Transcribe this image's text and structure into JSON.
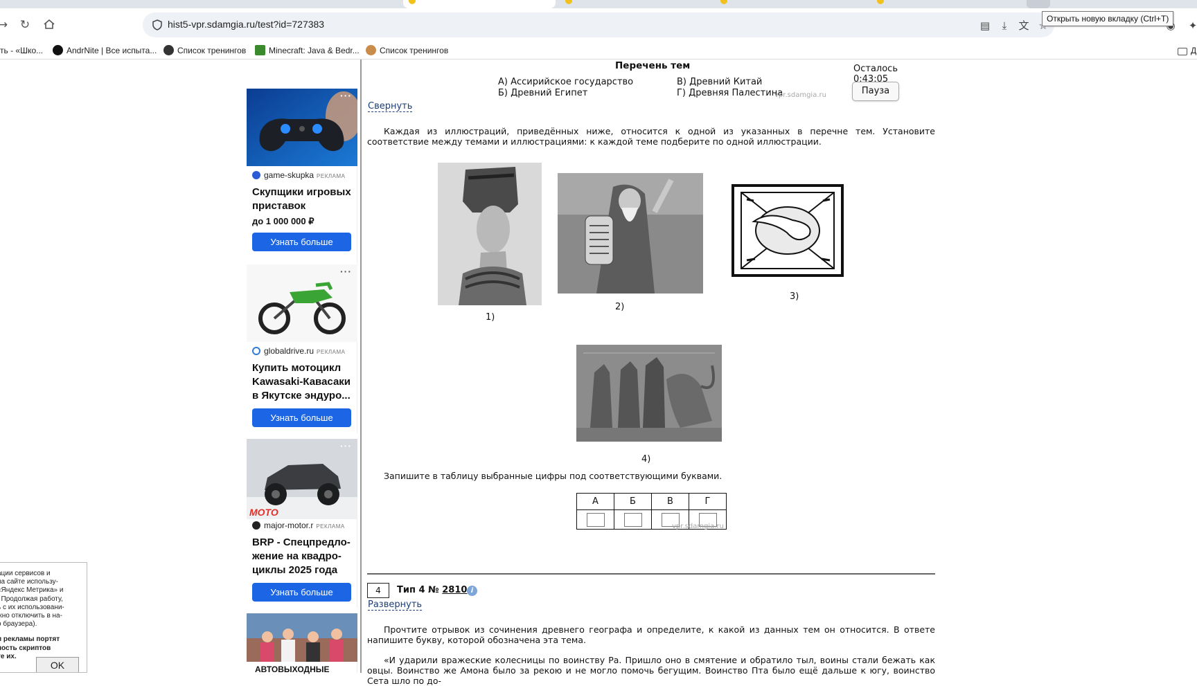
{
  "browser": {
    "url": "hist5-vpr.sdamgia.ru/test?id=727383",
    "tooltip": "Открыть новую вкладку (Ctrl+T)",
    "bookmarks": [
      {
        "label": "ть - «Шко..."
      },
      {
        "label": "AndrNite | Все испыта..."
      },
      {
        "label": "Список тренингов"
      },
      {
        "label": "Minecraft: Java & Bedr..."
      },
      {
        "label": "Список тренингов"
      },
      {
        "label": "Д"
      }
    ]
  },
  "cookie_banner": {
    "text": "ации сервисов и\n на сайте использу-\n «Яндекс Метрика» и\n. Продолжая работу,\nь с их использовани-\nжно отключить в на-\nо браузера).",
    "bold_text": "и рекламы портят\nность скриптов\nте их.",
    "ok_label": "OK"
  },
  "ads": [
    {
      "source": "game-skupka",
      "ad_label": "РЕКЛАМА",
      "title": "Скупщики игровых приставок",
      "price": "до 1 000 000 ₽",
      "button": "Узнать больше"
    },
    {
      "source": "globaldrive.ru",
      "ad_label": "РЕКЛАМА",
      "title": "Купить мотоцикл Kawasaki-Кавасаки в Якутске эндуро...",
      "button": "Узнать больше"
    },
    {
      "source": "major-motor.r",
      "ad_label": "РЕКЛАМА",
      "title": "BRP - Спецпредло-жение на квадро-циклы 2025 года",
      "button": "Узнать больше",
      "img_text": "MOTO"
    },
    {
      "title": "АВТОВЫХОДНЫЕ"
    }
  ],
  "task": {
    "topics_title": "Перечень тем",
    "topics": {
      "a": "А) Ассирийское государство",
      "b": "Б) Древний Египет",
      "v": "В) Древний Китай",
      "g": "Г) Древняя Палестина"
    },
    "watermark": "vpr.sdamgia.ru",
    "timer": "Осталось 0:43:05",
    "pause_label": "Пауза",
    "collapse_label": "Свернуть",
    "instruction": "Каждая из иллюстраций, приведённых ниже, относится к одной из указанных в перечне тем. Установите соответствие между темами и иллюстрациями: к каждой теме подберите по одной иллюстрации.",
    "captions": [
      "1)",
      "2)",
      "3)",
      "4)"
    ],
    "table_instruction": "Запишите в таблицу выбранные цифры под соответствующими буквами.",
    "table_headers": [
      "А",
      "Б",
      "В",
      "Г"
    ]
  },
  "next_task": {
    "number": "4",
    "type_prefix": "Тип 4 №",
    "id": "2810",
    "expand_label": "Развернуть",
    "instruction": "Прочтите отрывок из сочинения древнего географа и определите, к какой из данных тем он относится. В ответе напишите букву, которой обозначена эта тема.",
    "quote": "«И ударили вражеские колесницы по воинству Ра. Пришло оно в смятение и обратило тыл, воины стали бежать как овцы. Воинство же Амона было за рекою и не могло помочь бегущим. Воинство Пта было ещё дальше к югу, воинство Сета шло по до-"
  },
  "colors": {
    "accent_button": "#1c66e5",
    "link": "#1a3e7a"
  }
}
